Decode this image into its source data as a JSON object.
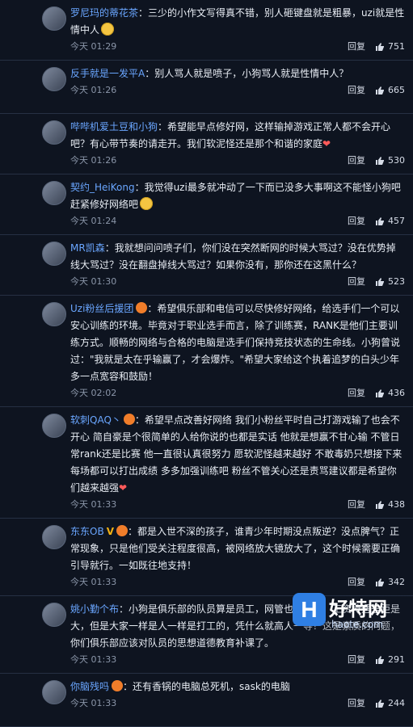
{
  "labels": {
    "reply": "回复"
  },
  "comments": [
    {
      "user": "罗尼玛的蒂花茶",
      "content": "：三少的小作文写得真不错，别人砸键盘就是粗暴，uzi就是性情中人",
      "time": "今天 01:29",
      "likes": "751"
    },
    {
      "user": "反手就是一发平A",
      "content": "：别人骂人就是喷子，小狗骂人就是性情中人？",
      "time": "今天 01:26",
      "likes": "665"
    },
    {
      "user": "哔哔机爱土豆和小狗",
      "content": "：希望能早点修好网，这样输掉游戏正常人都不会开心吧？有心带节奏的请走开。我们软泥怪还是那个和谐的家庭",
      "time": "今天 01:26",
      "likes": "530"
    },
    {
      "user": "契约_HeiKong",
      "content": "：我觉得uzi最多就冲动了一下而已没多大事啊这不能怪小狗吧赶紧修好网络吧",
      "time": "今天 01:24",
      "likes": "457"
    },
    {
      "user": "MR凯森",
      "content": "：我就想问问喷子们，你们没在突然断网的时候大骂过？没在优势掉线大骂过？没在翻盘掉线大骂过？如果你没有，那你还在这黑什么？",
      "time": "今天 01:30",
      "likes": "523"
    },
    {
      "user": "Uzi粉丝后援团",
      "content": "：希望俱乐部和电信可以尽快修好网络，给选手们一个可以安心训练的环境。毕竟对于职业选手而言，除了训练赛，RANK是他们主要训练方式。顺畅的网络与合格的电脑是选手们保持竞技状态的生命线。小狗曾说过：\"我就是太在乎输赢了，才会爆炸。\"希望大家给这个执着追梦的白头少年多一点宽容和鼓励！",
      "time": "今天 02:02",
      "likes": "436"
    },
    {
      "user": "软刺QAQ丶",
      "content": "：希望早点改善好网络 我们小粉丝平时自己打游戏输了也会不开心 简自豪是个很简单的人给你说的也都是实话 他就是想赢不甘心输 不管日常rank还是比赛 他一直很认真很努力 愿软泥怪越来越好 不敢毒奶只想接下来每场都可以打出成绩 多多加强训练吧 粉丝不管关心还是责骂建议都是希望你们越来越强",
      "time": "今天 01:33",
      "likes": "438"
    },
    {
      "user": "东东OB",
      "content": "：都是入世不深的孩子，谁青少年时期没点叛逆？没点脾气？正常现象，只是他们受关注程度很高，被网络放大镜放大了，这个时候需要正确引导就行。一如既往地支持！",
      "time": "今天 01:33",
      "likes": "342"
    },
    {
      "user": "姚小勤个布",
      "content": "：小狗是俱乐部的队员算是员工，网管也是员工，工资待遇差距是大，但是大家一样是人一样是打工的，凭什么就高人一等？这是素质的问题，你们俱乐部应该对队员的思想道德教育补课了。",
      "time": "今天 01:33",
      "likes": "291"
    },
    {
      "user": "你脑残吗",
      "content": "：还有香锅的电脑总死机，sask的电脑",
      "time": "今天 01:33",
      "likes": "244"
    }
  ],
  "watermark": {
    "title": "好特网",
    "url": "haote.com"
  }
}
